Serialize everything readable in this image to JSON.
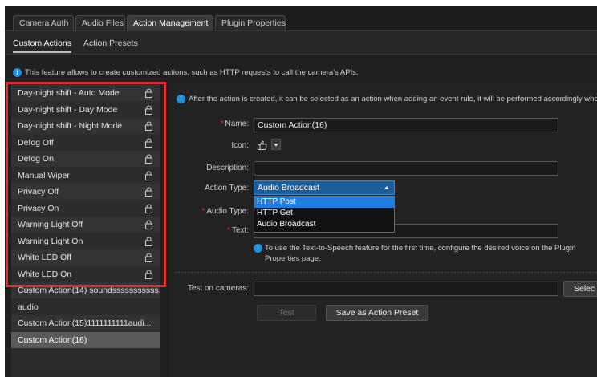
{
  "tabs": [
    {
      "label": "Camera Auth",
      "active": false
    },
    {
      "label": "Audio Files",
      "active": false
    },
    {
      "label": "Action Management",
      "active": true
    },
    {
      "label": "Plugin Properties",
      "active": false
    }
  ],
  "subtabs": [
    {
      "label": "Custom Actions",
      "active": true
    },
    {
      "label": "Action Presets",
      "active": false
    }
  ],
  "feature_note": "This feature allows to create customized actions, such as HTTP requests to call the camera's APIs.",
  "action_list": [
    {
      "label": "Day-night shift - Auto Mode",
      "locked": true
    },
    {
      "label": "Day-night shift - Day Mode",
      "locked": true
    },
    {
      "label": "Day-night shift - Night Mode",
      "locked": true
    },
    {
      "label": "Defog Off",
      "locked": true
    },
    {
      "label": "Defog On",
      "locked": true
    },
    {
      "label": "Manual Wiper",
      "locked": true
    },
    {
      "label": "Privacy Off",
      "locked": true
    },
    {
      "label": "Privacy On",
      "locked": true
    },
    {
      "label": "Warning Light Off",
      "locked": true
    },
    {
      "label": "Warning Light On",
      "locked": true
    },
    {
      "label": "White LED Off",
      "locked": true
    },
    {
      "label": "White LED On",
      "locked": true
    },
    {
      "label": "Custom Action(14) soundsssssssssss...",
      "locked": false
    },
    {
      "label": "audio",
      "locked": false
    },
    {
      "label": "Custom Action(15)1111111111audi...",
      "locked": false
    },
    {
      "label": "Custom Action(16)",
      "locked": false,
      "selected": true
    }
  ],
  "form": {
    "after_note": "After the action is created, it can be selected as an action when adding an event rule, it will be performed accordingly when",
    "name_label": "Name:",
    "name_value": "Custom Action(16)",
    "icon_label": "Icon:",
    "icon_value": "thumbs-up-icon",
    "description_label": "Description:",
    "description_value": "",
    "action_type_label": "Action Type:",
    "action_type_value": "Audio Broadcast",
    "action_type_options": [
      "HTTP Post",
      "HTTP Get",
      "Audio Broadcast"
    ],
    "action_type_highlighted": "HTTP Post",
    "audio_type_label": "Audio Type:",
    "text_label": "Text:",
    "text_value": "",
    "tts_note": "To use the Text-to-Speech feature for the first time, configure the desired voice on the Plugin Properties page.",
    "test_cameras_label": "Test on cameras:",
    "test_cameras_value": "",
    "select_button": "Selec",
    "test_button": "Test",
    "save_preset_button": "Save as Action Preset"
  },
  "colors": {
    "highlight_box": "#e0302f",
    "accent_blue": "#1e7fe0",
    "required_marker": "#e0302f"
  }
}
